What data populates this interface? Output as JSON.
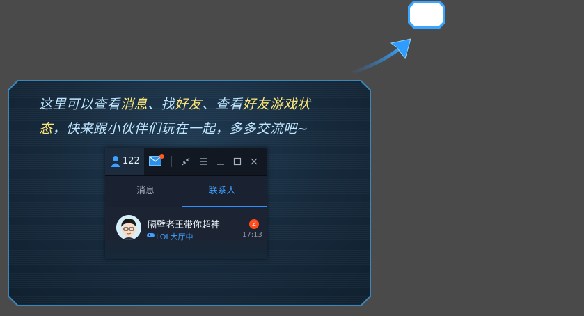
{
  "tooltip": {
    "line1_a": "这里可以查看",
    "line1_b": "消息",
    "line1_c": "、找",
    "line1_d": "好友",
    "line1_e": "、查看",
    "line1_f": "好友游戏状",
    "line2_a": "态",
    "line2_b": "，快来跟小伙伴们玩在一起，多多交流吧~"
  },
  "panel": {
    "contact_count": "122",
    "tabs": {
      "messages": "消息",
      "contacts": "联系人"
    },
    "contact": {
      "name": "隔壁老王带你超神",
      "status": "LOL大厅中",
      "unread": "2",
      "time": "17:13"
    }
  },
  "colors": {
    "highlight": "#ffe97a",
    "text": "#bfe6ff",
    "accent": "#3ea0ff",
    "badge": "#ff4a1c"
  }
}
